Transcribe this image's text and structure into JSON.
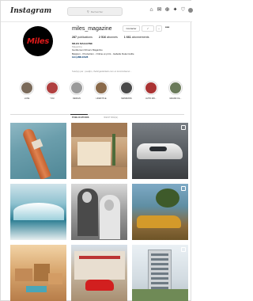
{
  "app": {
    "logo_text": "Instagram"
  },
  "search": {
    "placeholder": "Rechercher"
  },
  "nav": {
    "icons": [
      "home-icon",
      "messenger-icon",
      "new-post-icon",
      "explore-icon",
      "heart-icon",
      "profile-avatar"
    ]
  },
  "profile": {
    "username": "miles_magazine",
    "avatar_text": "Miles",
    "buttons": {
      "contact": "Contacter",
      "follow_icon": "✓",
      "more": "⌄"
    },
    "more_dots": "•••",
    "stats": {
      "posts_value": "287",
      "posts_label": "publications",
      "followers_value": "2 516",
      "followers_label": "abonnés",
      "following_value": "1 661",
      "following_label": "abonnements"
    },
    "bio": {
      "name": "MILES MAGAZINE",
      "category": "Magazine",
      "line1": "Gentlemen Drivers Magazine",
      "line2": "Belgium - Production - Online et print - Isabelle Delecroxille",
      "link": "bit.ly/MILES28"
    },
    "followed_by": "Suivi(e) par : pauljlm, thebrigadeblack.com et dominiclaurel..."
  },
  "highlights": [
    {
      "label": "LUXE",
      "color": "#7a6a5a"
    },
    {
      "label": "YOU",
      "color": "#b04040"
    },
    {
      "label": "DESIGN",
      "color": "#9a9a9a"
    },
    {
      "label": "LIFESTYLE",
      "color": "#8a6a4a"
    },
    {
      "label": "MANSIONS",
      "color": "#4a4a4a"
    },
    {
      "label": "AUTO MO...",
      "color": "#a33"
    },
    {
      "label": "GRAND CA...",
      "color": "#6a7a5a"
    }
  ],
  "tabs": {
    "posts": "PUBLICATIONS",
    "tagged": "IDENTIFIÉ(E)"
  }
}
